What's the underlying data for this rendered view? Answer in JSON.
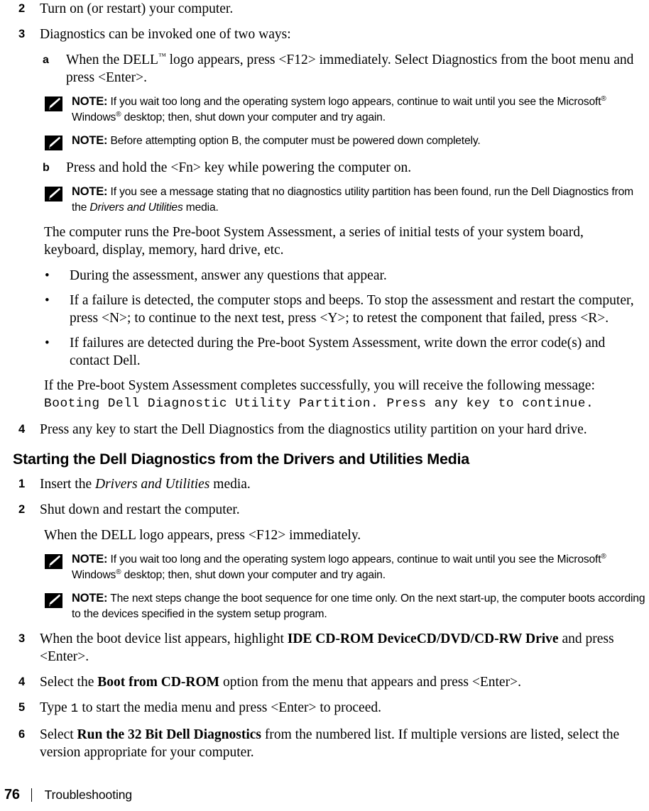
{
  "document": {
    "footer": {
      "page_number": "76",
      "section_title": "Troubleshooting",
      "separator": "|"
    }
  },
  "note_icon_name": "pencil-note-icon",
  "note_label": "NOTE:",
  "bullet_glyph": "•",
  "steps_top": [
    {
      "marker": "2",
      "text": "Turn on (or restart) your computer."
    },
    {
      "marker": "3",
      "text": "Diagnostics can be invoked one of two ways:"
    }
  ],
  "substep_a": {
    "marker": "a",
    "text_part1": "When the DELL",
    "trademark": "™",
    "text_part2": " logo appears, press <F12> immediately. Select Diagnostics from the boot menu and press <Enter>."
  },
  "note_1": {
    "label": "NOTE:",
    "text_part1": " If you wait too long and the operating system logo appears, continue to wait until you see the Microsoft",
    "reg1": "®",
    "text_part2": " Windows",
    "reg2": "®",
    "text_part3": " desktop; then, shut down your computer and try again."
  },
  "note_2": {
    "label": "NOTE:",
    "text": " Before attempting option B, the computer must be powered down completely."
  },
  "substep_b": {
    "marker": "b",
    "text": "Press and hold the <Fn> key while powering the computer on."
  },
  "note_3": {
    "label": "NOTE:",
    "text_part1": " If you see a message stating that no diagnostics utility partition has been found, run the Dell Diagnostics from the ",
    "italic": "Drivers and Utilities",
    "text_part2": " media."
  },
  "paragraph_assessment": "The computer runs the Pre-boot System Assessment, a series of initial tests of your system board, keyboard, display, memory, hard drive, etc.",
  "bullets": [
    {
      "text": "During the assessment, answer any questions that appear."
    },
    {
      "text": "If a failure is detected, the computer stops and beeps. To stop the assessment and restart the computer, press <N>; to continue to the next test, press <Y>; to retest the component that failed, press <R>."
    },
    {
      "text": "If failures are detected during the Pre-boot System Assessment, write down the error code(s) and contact Dell."
    }
  ],
  "paragraph_success": "If the Pre-boot System Assessment completes successfully, you will receive the following message:",
  "console_message": "Booting Dell Diagnostic Utility Partition. Press any key to continue.",
  "step_4_top": {
    "marker": "4",
    "text": "Press any key to start the Dell Diagnostics from the diagnostics utility partition on your hard drive."
  },
  "section_heading": "Starting the Dell Diagnostics from the Drivers and Utilities Media",
  "step_1_media": {
    "marker": "1",
    "text_part1": "Insert the ",
    "italic": "Drivers and Utilities",
    "text_part2": " media."
  },
  "step_2_media": {
    "marker": "2",
    "text": "Shut down and restart the computer."
  },
  "paragraph_dell_logo": "When the DELL logo appears, press <F12> immediately.",
  "note_4": {
    "label": "NOTE:",
    "text_part1": " If you wait too long and the operating system logo appears, continue to wait until you see the Microsoft",
    "reg1": "®",
    "text_part2": " Windows",
    "reg2": "®",
    "text_part3": " desktop; then, shut down your computer and try again."
  },
  "note_5": {
    "label": "NOTE:",
    "text": " The next steps change the boot sequence for one time only. On the next start-up, the computer boots according to the devices specified in the system setup program."
  },
  "step_3_media": {
    "marker": "3",
    "text_part1": "When the boot device list appears, highlight ",
    "bold": "IDE CD-ROM DeviceCD/DVD/CD-RW Drive",
    "text_part2": " and press <Enter>."
  },
  "step_4_media": {
    "marker": "4",
    "text_part1": "Select the ",
    "bold": "Boot from CD-ROM",
    "text_part2": " option from the menu that appears and press <Enter>."
  },
  "step_5_media": {
    "marker": "5",
    "text_part1": "Type ",
    "mono": "1",
    "text_part2": " to start the media menu and press <Enter> to proceed."
  },
  "step_6_media": {
    "marker": "6",
    "text_part1": "Select ",
    "bold": "Run the 32 Bit Dell Diagnostics",
    "text_part2": " from the numbered list. If multiple versions are listed, select the version appropriate for your computer."
  }
}
